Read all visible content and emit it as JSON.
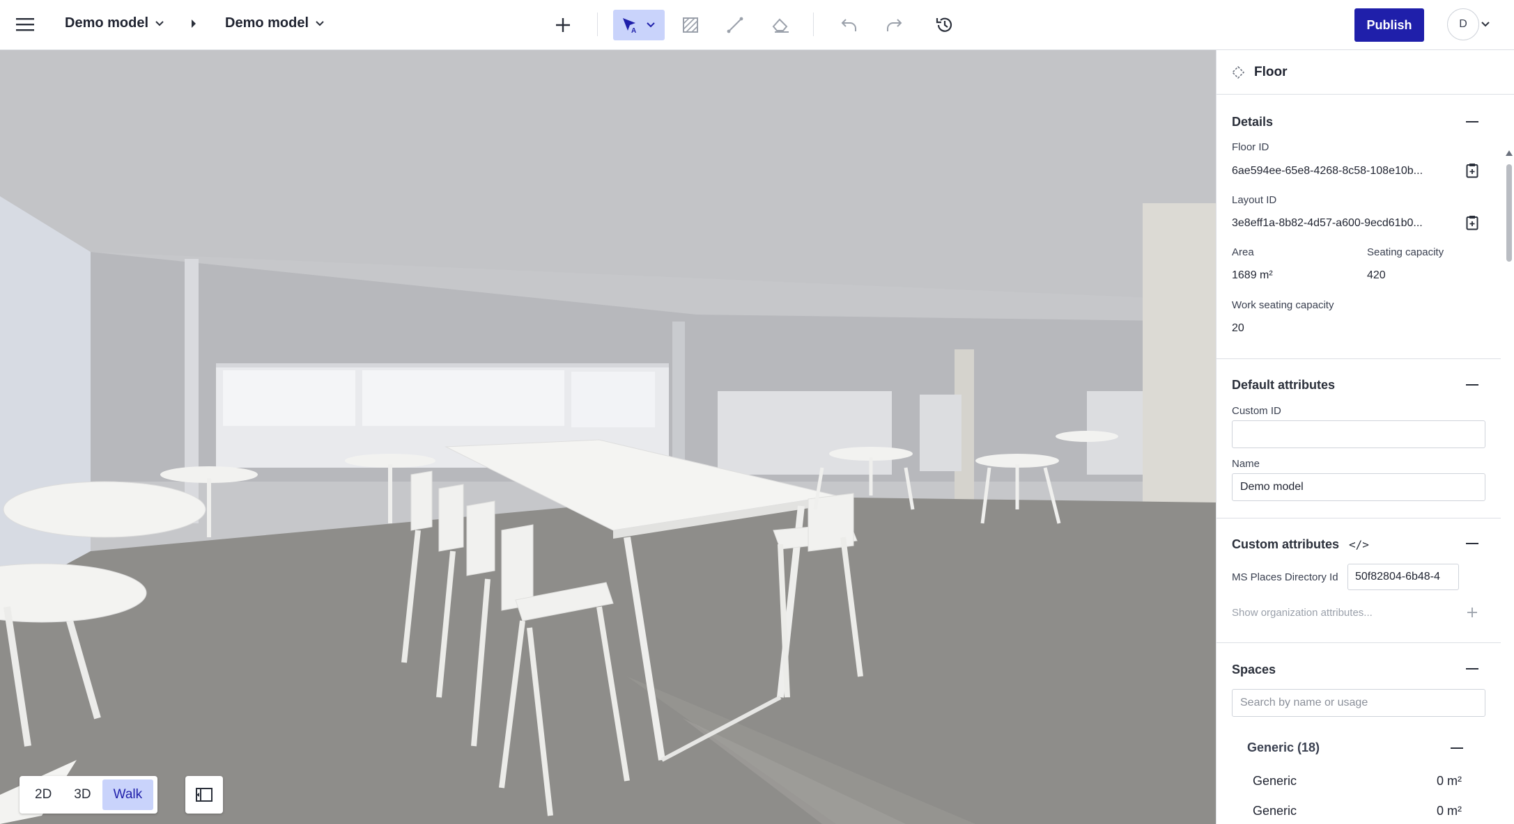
{
  "topbar": {
    "breadcrumb": [
      "Demo model",
      "Demo model"
    ],
    "publish_label": "Publish",
    "avatar_initial": "D",
    "tools": [
      "add-icon",
      "select-icon",
      "hatch-icon",
      "line-icon",
      "erase-icon",
      "undo-icon",
      "redo-icon",
      "history-icon"
    ]
  },
  "viewport": {
    "view_modes": [
      "2D",
      "3D",
      "Walk"
    ],
    "active_view_mode": "Walk"
  },
  "panel": {
    "title": "Floor",
    "details": {
      "title": "Details",
      "floor_id_label": "Floor ID",
      "floor_id_value": "6ae594ee-65e8-4268-8c58-108e10b...",
      "layout_id_label": "Layout ID",
      "layout_id_value": "3e8eff1a-8b82-4d57-a600-9ecd61b0...",
      "area_label": "Area",
      "area_value": "1689 m²",
      "seating_label": "Seating capacity",
      "seating_value": "420",
      "work_seating_label": "Work seating capacity",
      "work_seating_value": "20"
    },
    "default_attributes": {
      "title": "Default attributes",
      "custom_id_label": "Custom ID",
      "custom_id_value": "",
      "name_label": "Name",
      "name_value": "Demo model"
    },
    "custom_attributes": {
      "title": "Custom attributes",
      "code_symbol": "</>",
      "ms_places_label": "MS Places Directory Id",
      "ms_places_value": "50f82804-6b48-4",
      "show_org_label": "Show organization attributes..."
    },
    "spaces": {
      "title": "Spaces",
      "search_placeholder": "Search by name or usage",
      "group_label": "Generic (18)",
      "items": [
        {
          "name": "Generic",
          "area": "0 m²"
        },
        {
          "name": "Generic",
          "area": "0 m²"
        }
      ]
    }
  }
}
